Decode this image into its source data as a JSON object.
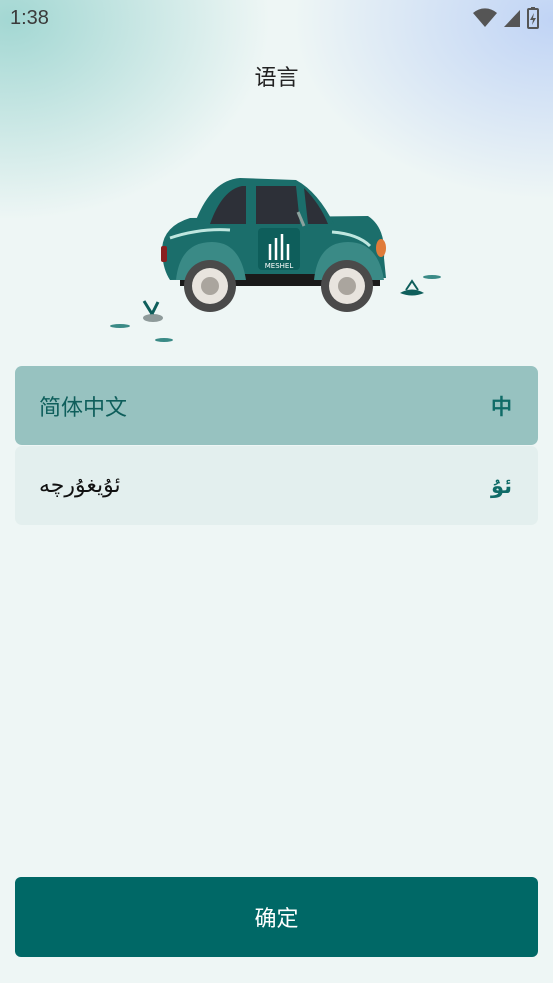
{
  "status_bar": {
    "time": "1:38",
    "icons": [
      "wifi-icon",
      "cellular-signal-icon",
      "battery-icon"
    ]
  },
  "header": {
    "title": "语言"
  },
  "hero": {
    "logo_text": "MESHEL",
    "icon": "car-illustration"
  },
  "languages": [
    {
      "name": "简体中文",
      "badge": "中",
      "selected": true
    },
    {
      "name": "ئۇيغۇرچە",
      "badge": "ئۇ",
      "selected": false
    }
  ],
  "confirm_label": "确定",
  "colors": {
    "primary": "#006866",
    "selected_bg": "#97c2c0",
    "unselected_bg": "#e3efee",
    "car_body": "#1b6e6b"
  }
}
